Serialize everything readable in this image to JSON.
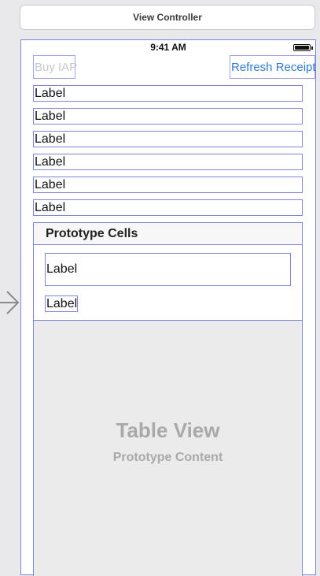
{
  "scene": {
    "title": "View Controller"
  },
  "status_bar": {
    "time": "9:41 AM"
  },
  "buttons": {
    "buy_iap": "Buy IAP",
    "refresh_receipt": "Refresh Receipt"
  },
  "labels": [
    "Label",
    "Label",
    "Label",
    "Label",
    "Label",
    "Label"
  ],
  "table": {
    "section_header": "Prototype Cells",
    "cell_labels": [
      "Label",
      "Label"
    ],
    "placeholder_title": "Table View",
    "placeholder_subtitle": "Prototype Content"
  },
  "icons": {
    "entry_arrow": "initial-view-controller-arrow-icon",
    "battery": "battery-icon"
  },
  "colors": {
    "selection_outline": "#7f86e0",
    "button_blue": "#2f7bd6",
    "disabled_text": "#c8c8cc"
  }
}
